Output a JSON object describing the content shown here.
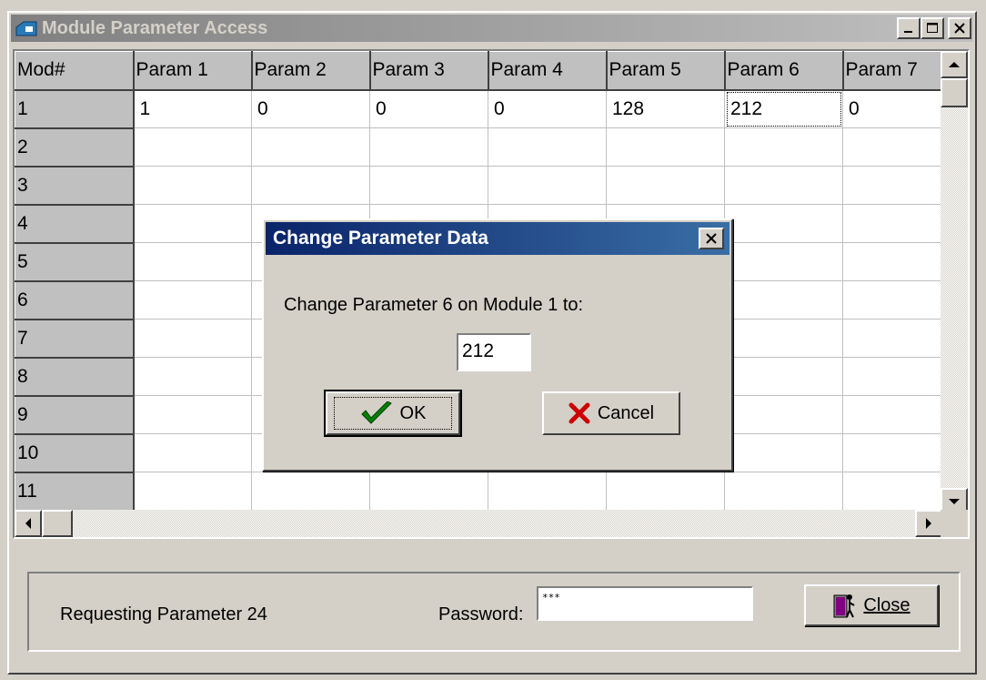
{
  "window": {
    "title": "Module Parameter Access"
  },
  "grid": {
    "headers": [
      "Mod#",
      "Param 1",
      "Param 2",
      "Param 3",
      "Param 4",
      "Param 5",
      "Param 6",
      "Param 7"
    ],
    "rows": [
      [
        "1",
        "1",
        "0",
        "0",
        "0",
        "128",
        "212",
        "0"
      ],
      [
        "2",
        "",
        "",
        "",
        "",
        "",
        "",
        ""
      ],
      [
        "3",
        "",
        "",
        "",
        "",
        "",
        "",
        ""
      ],
      [
        "4",
        "",
        "",
        "",
        "",
        "",
        "",
        ""
      ],
      [
        "5",
        "",
        "",
        "",
        "",
        "",
        "",
        ""
      ],
      [
        "6",
        "",
        "",
        "",
        "",
        "",
        "",
        ""
      ],
      [
        "7",
        "",
        "",
        "",
        "",
        "",
        "",
        ""
      ],
      [
        "8",
        "",
        "",
        "",
        "",
        "",
        "",
        ""
      ],
      [
        "9",
        "",
        "",
        "",
        "",
        "",
        "",
        ""
      ],
      [
        "10",
        "",
        "",
        "",
        "",
        "",
        "",
        ""
      ],
      [
        "11",
        "",
        "",
        "",
        "",
        "",
        "",
        ""
      ]
    ]
  },
  "status": {
    "message": "Requesting Parameter 24",
    "password_label": "Password:",
    "password_value": "***",
    "close_label": "Close"
  },
  "dialog": {
    "title": "Change Parameter Data",
    "prompt": "Change Parameter 6 on Module 1 to:",
    "value": "212",
    "ok_label": "OK",
    "cancel_label": "Cancel"
  }
}
